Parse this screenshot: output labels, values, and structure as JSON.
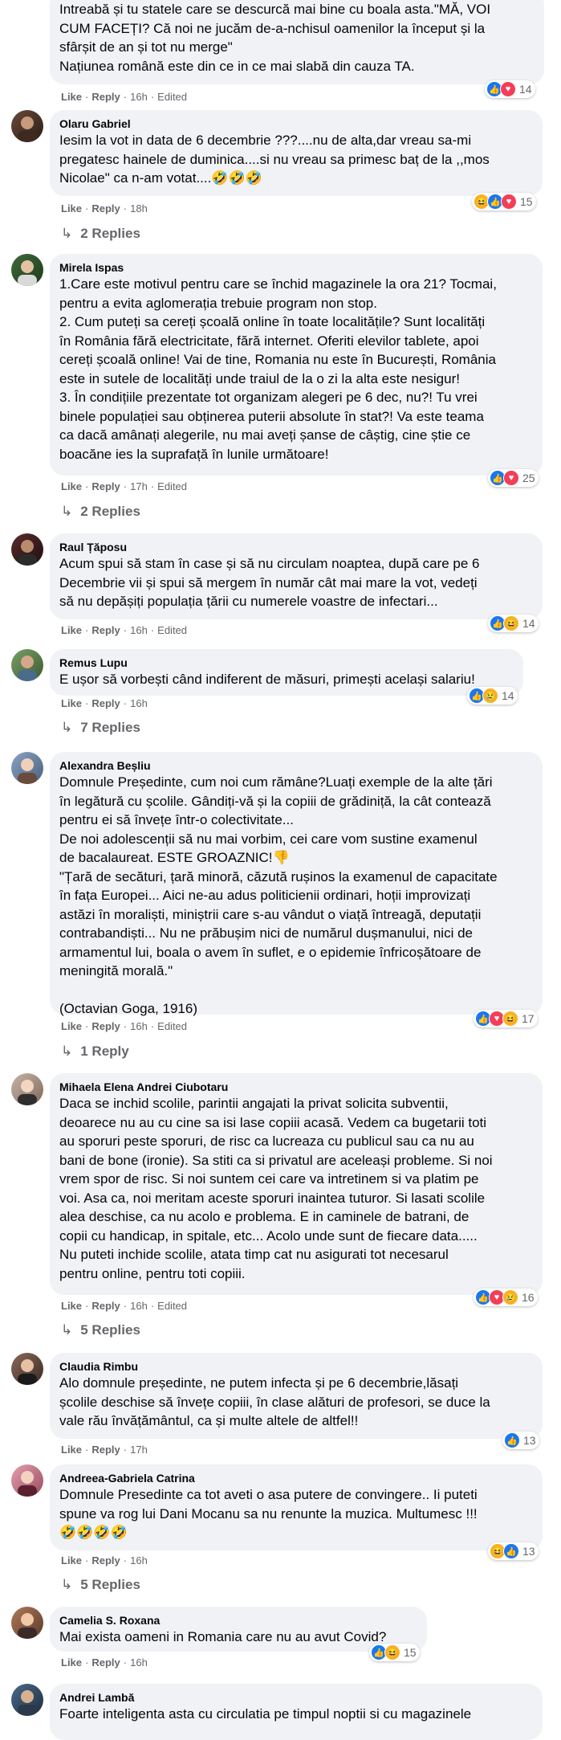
{
  "comments": [
    {
      "author": "",
      "text": "Intreabă și tu statele care se descurcă mai bine cu boala asta.\"MĂ, VOI\nCUM FACEȚI? Că noi ne jucăm de-a-nchisul oamenilor la început și la\nsfârșit de an și tot nu merge\"\nNațiunea română este din ce in ce mai slabă din cauza TA.",
      "like": "Like",
      "reply": "Reply",
      "time": "16h",
      "edited": "Edited",
      "reactions": [
        "like",
        "love"
      ],
      "count": "14",
      "replies": ""
    },
    {
      "author": "Olaru Gabriel",
      "text": "Iesim la vot in data de 6 decembrie ???....nu de alta,dar vreau sa-mi\npregatesc hainele de duminica....si nu vreau sa primesc baț de la ,,mos\nNicolae\" ca n-am votat....🤣🤣🤣",
      "like": "Like",
      "reply": "Reply",
      "time": "18h",
      "edited": "",
      "reactions": [
        "haha",
        "like",
        "love"
      ],
      "count": "15",
      "replies": "2 Replies"
    },
    {
      "author": "Mirela Ispas",
      "text": "1.Care este motivul pentru care se închid magazinele la ora 21? Tocmai,\npentru a evita aglomerația trebuie program non stop.\n2. Cum puteți sa cereți școală online în toate localitățile? Sunt localități\nîn România fără electricitate, fără internet. Oferiti elevilor tablete, apoi\ncereți școală online! Vai de tine, Romania nu este în București, România\neste in sutele de localități unde traiul de la o zi la alta este nesigur!\n3. În condițiile prezentate tot organizam alegeri pe 6 dec, nu?! Tu vrei\nbinele populației sau obținerea puterii absolute în stat?! Va este teama\nca dacă amânați alegerile, nu mai aveți șanse de câștig, cine știe ce\nboacăne ies la suprafață în lunile următoare!",
      "like": "Like",
      "reply": "Reply",
      "time": "17h",
      "edited": "Edited",
      "reactions": [
        "like",
        "love"
      ],
      "count": "25",
      "replies": "2 Replies"
    },
    {
      "author": "Raul Țăposu",
      "text": "Acum spui să stam în case și să nu circulam noaptea, după care pe 6\nDecembrie vii și spui să mergem în număr cât mai mare la vot, vedeți\nsă nu depășiți populația țării cu numerele voastre de infectari...",
      "like": "Like",
      "reply": "Reply",
      "time": "16h",
      "edited": "Edited",
      "reactions": [
        "like",
        "haha"
      ],
      "count": "14",
      "replies": ""
    },
    {
      "author": "Remus Lupu",
      "text": "E ușor să vorbești când indiferent de măsuri, primești același salariu!",
      "like": "Like",
      "reply": "Reply",
      "time": "16h",
      "edited": "",
      "reactions": [
        "like",
        "sad"
      ],
      "count": "14",
      "replies": "7 Replies"
    },
    {
      "author": "Alexandra Beșliu",
      "text": "Domnule Președinte, cum noi cum rămâne?Luați exemple de la alte țări\nîn legătură cu școlile. Gândiți-vă și la copiii de grădiniță, la cât contează\npentru ei să învețe într-o colectivitate...\nDe noi adolescenții să nu mai vorbim, cei care vom sustine examenul\nde bacalaureat. ESTE GROAZNIC!👎\n\"Țară de secături, țară minoră, căzută rușinos la examenul de capacitate\nîn fața Europei... Aici ne-au adus politicienii ordinari, hoții improvizați\nastăzi în moraliști, miniștrii care s-au vândut o viață întreagă, deputații\ncontrabandiști... Nu ne prăbușim nici de numărul dușmanului, nici de\narmamentul lui, boala o avem în suflet, e o epidemie înfricoșătoare de\nmeningită morală.\"\n\n(Octavian Goga, 1916)",
      "like": "Like",
      "reply": "Reply",
      "time": "16h",
      "edited": "Edited",
      "reactions": [
        "like",
        "love",
        "haha"
      ],
      "count": "17",
      "replies": "1 Reply"
    },
    {
      "author": "Mihaela Elena Andrei Ciubotaru",
      "text": "Daca se inchid scolile, parintii angajati la privat solicita subventii,\ndeoarece nu au cu cine sa isi lase copiii acasă. Vedem ca bugetarii toti\nau sporuri peste sporuri, de risc ca lucreaza cu publicul sau ca nu au\nbani de bone (ironie). Sa stiti ca si privatul are aceleași probleme. Si noi\nvrem spor de risc. Si noi suntem cei care va intretinem si va platim pe\nvoi. Asa ca, noi meritam aceste sporuri inaintea tuturor. Si lasati scolile\nalea deschise, ca nu acolo e problema. E in caminele de batrani, de\ncopii cu handicap, in spitale, etc... Acolo unde sunt de fiecare data.....\nNu puteti inchide scolile, atata timp cat nu asigurati tot necesarul\npentru online, pentru toti copiii.",
      "like": "Like",
      "reply": "Reply",
      "time": "16h",
      "edited": "Edited",
      "reactions": [
        "like",
        "love",
        "sad"
      ],
      "count": "16",
      "replies": "5 Replies"
    },
    {
      "author": "Claudia Rimbu",
      "text": "Alo domnule președinte, ne putem infecta și pe 6 decembrie,lăsați\nșcolile deschise să învețe copiii, în clase alături de profesori, se duce la\nvale rău învățământul, ca și multe altele de altfel!!",
      "like": "Like",
      "reply": "Reply",
      "time": "17h",
      "edited": "",
      "reactions": [
        "like"
      ],
      "count": "13",
      "replies": ""
    },
    {
      "author": "Andreea-Gabriela Catrina",
      "text": "Domnule Presedinte ca tot aveti o asa putere de convingere.. Ii puteti\nspune va rog lui Dani Mocanu sa nu renunte la muzica. Multumesc !!!\n🤣🤣🤣🤣",
      "like": "Like",
      "reply": "Reply",
      "time": "16h",
      "edited": "",
      "reactions": [
        "haha",
        "like"
      ],
      "count": "13",
      "replies": "5 Replies"
    },
    {
      "author": "Camelia S. Roxana",
      "text": "Mai exista oameni in Romania care nu au avut Covid?",
      "like": "Like",
      "reply": "Reply",
      "time": "16h",
      "edited": "",
      "reactions": [
        "like",
        "haha"
      ],
      "count": "15",
      "replies": ""
    },
    {
      "author": "Andrei Lambă",
      "text": "Foarte inteligenta asta cu circulatia pe timpul noptii si cu magazinele",
      "like": "",
      "reply": "",
      "time": "",
      "edited": "",
      "reactions": [],
      "count": "",
      "replies": ""
    }
  ]
}
